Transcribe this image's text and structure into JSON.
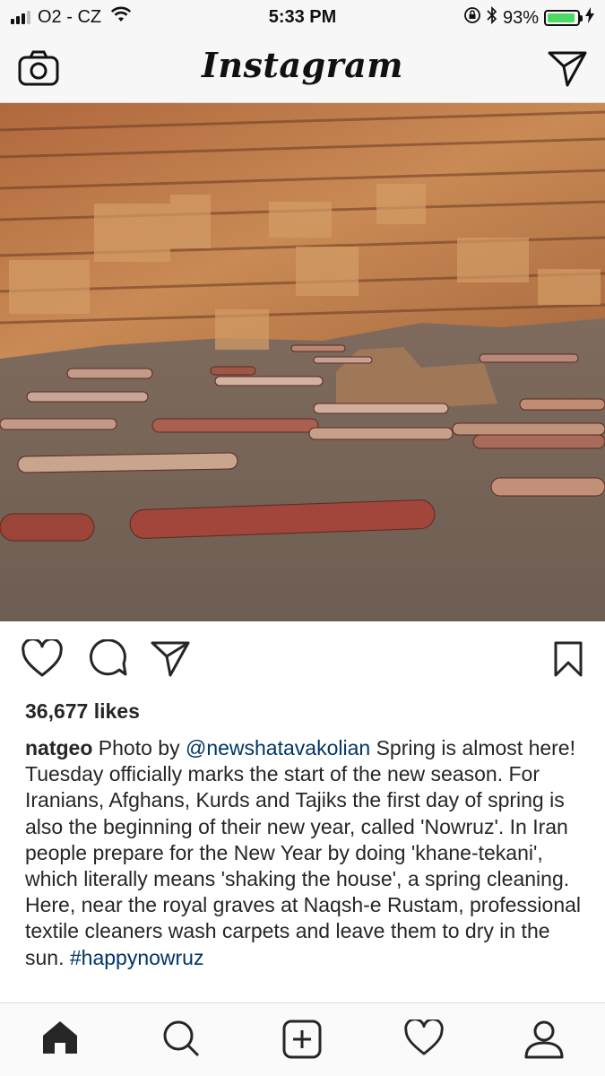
{
  "status_bar": {
    "carrier": "O2 - CZ",
    "time": "5:33 PM",
    "battery_percent": "93%",
    "battery_level": 0.93,
    "signal_bars": 3,
    "signal_bars_total": 4,
    "battery_color": "#4cd964"
  },
  "nav": {
    "logo": "Instagram",
    "left_icon": "camera-icon",
    "right_icon": "direct-send-icon"
  },
  "post": {
    "photo_alt": "rolled carpets drying on rocky ground below a cliff",
    "likes": "36,677 likes",
    "username": "natgeo",
    "caption_prefix": "Photo by",
    "credit": "@newshatavakolian",
    "caption_body": "Spring is almost here! Tuesday officially marks the start of the new season. For Iranians, Afghans, Kurds and Tajiks the first day of spring is also the beginning of their new year, called 'Nowruz'. In Iran people prepare for the New Year by doing 'khane-tekani', which literally means 'shaking the house', a spring cleaning. Here, near the royal graves at Naqsh-e Rustam, professional textile cleaners wash carpets and leave them to dry in the sun.",
    "hashtag": "#happynowruz",
    "actions": [
      "heart-icon",
      "comment-icon",
      "share-icon",
      "bookmark-icon"
    ]
  },
  "tabbar": {
    "items": [
      "home-icon",
      "search-icon",
      "add-post-icon",
      "activity-heart-icon",
      "profile-icon"
    ]
  },
  "colors": {
    "link": "#003569",
    "text": "#262626",
    "bar_bg": "#f7f7f7",
    "border": "#dbdbdb"
  }
}
